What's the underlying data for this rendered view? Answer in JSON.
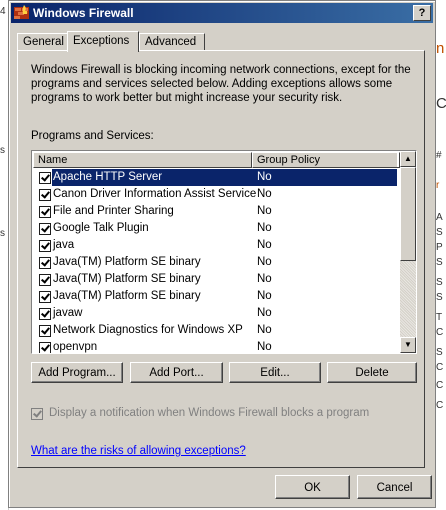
{
  "window": {
    "title": "Windows Firewall",
    "help_button": "?"
  },
  "tabs": [
    {
      "label": "General"
    },
    {
      "label": "Exceptions"
    },
    {
      "label": "Advanced"
    }
  ],
  "active_tab": "Exceptions",
  "description": "Windows Firewall is blocking incoming network connections, except for the programs and services selected below. Adding exceptions allows some programs to work better but might increase your security risk.",
  "programs_label": "Programs and Services:",
  "list": {
    "columns": [
      "Name",
      "Group Policy"
    ],
    "rows": [
      {
        "name": "Apache HTTP Server",
        "group_policy": "No",
        "checked": true,
        "selected": true
      },
      {
        "name": "Canon Driver Information Assist Service",
        "group_policy": "No",
        "checked": true
      },
      {
        "name": "File and Printer Sharing",
        "group_policy": "No",
        "checked": true
      },
      {
        "name": "Google Talk Plugin",
        "group_policy": "No",
        "checked": true
      },
      {
        "name": "java",
        "group_policy": "No",
        "checked": true
      },
      {
        "name": "Java(TM) Platform SE binary",
        "group_policy": "No",
        "checked": true
      },
      {
        "name": "Java(TM) Platform SE binary",
        "group_policy": "No",
        "checked": true
      },
      {
        "name": "Java(TM) Platform SE binary",
        "group_policy": "No",
        "checked": true
      },
      {
        "name": "javaw",
        "group_policy": "No",
        "checked": true
      },
      {
        "name": "Network Diagnostics for Windows XP",
        "group_policy": "No",
        "checked": true
      },
      {
        "name": "openvpn",
        "group_policy": "No",
        "checked": true
      }
    ]
  },
  "buttons": {
    "add_program": "Add Program...",
    "add_port": "Add Port...",
    "edit": "Edit...",
    "delete": "Delete",
    "ok": "OK",
    "cancel": "Cancel"
  },
  "notify": {
    "label": "Display a notification when Windows Firewall blocks a program",
    "checked": true,
    "disabled": true
  },
  "risk_link": "What are the risks of allowing exceptions?",
  "background": {
    "left_fragments": [
      "4",
      "s",
      "s"
    ],
    "right_fragments": [
      "n",
      "C",
      "#",
      "r",
      "A",
      "S",
      "P",
      "S",
      "S",
      "S",
      "T",
      "C",
      "S",
      "C",
      "C",
      "C"
    ]
  },
  "colors": {
    "dialog_bg": "#d4d0c8",
    "titlebar_start": "#0a246a",
    "titlebar_end": "#3a6ea5",
    "selection": "#0a246a",
    "link": "#0000ff"
  }
}
